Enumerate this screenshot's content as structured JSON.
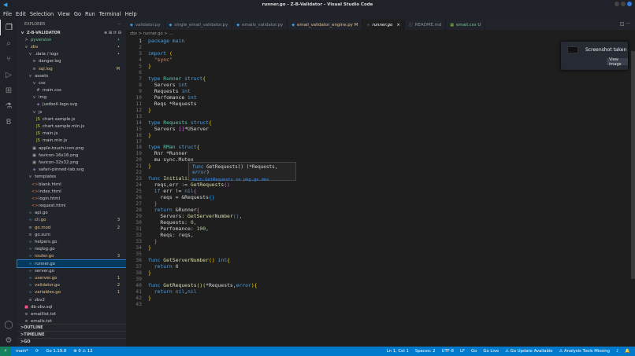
{
  "title": "runner.go - Z-B-Validator - Visual Studio Code",
  "menu": [
    "File",
    "Edit",
    "Selection",
    "View",
    "Go",
    "Run",
    "Terminal",
    "Help"
  ],
  "sidebar": {
    "header": "EXPLORER",
    "root": "Z-B-VALIDATOR",
    "items": [
      {
        "label": "pyversion",
        "indent": 1,
        "icon": ">",
        "color": "#73c991",
        "badge": "•"
      },
      {
        "label": "zbv",
        "indent": 1,
        "icon": "v",
        "color": "#e2c08d",
        "badge": "•"
      },
      {
        "label": ".data / logs",
        "indent": 2,
        "icon": "v",
        "color": "#ccc",
        "badge": "•"
      },
      {
        "label": "danger.log",
        "indent": 3,
        "icon": "≡",
        "color": "#ccc",
        "badge": ""
      },
      {
        "label": "sql.log",
        "indent": 3,
        "icon": "≡",
        "color": "#e2c08d",
        "badge": "M"
      },
      {
        "label": "assets",
        "indent": 2,
        "icon": "v",
        "color": "#ccc",
        "badge": ""
      },
      {
        "label": "css",
        "indent": 3,
        "icon": "v",
        "color": "#ccc",
        "badge": ""
      },
      {
        "label": "main.css",
        "indent": 4,
        "icon": "#",
        "color": "#ccc",
        "badge": ""
      },
      {
        "label": "img",
        "indent": 3,
        "icon": "v",
        "color": "#ccc",
        "badge": ""
      },
      {
        "label": "justboil-logo.svg",
        "indent": 4,
        "icon": "◈",
        "color": "#ccc",
        "badge": ""
      },
      {
        "label": "js",
        "indent": 3,
        "icon": "v",
        "color": "#ccc",
        "badge": ""
      },
      {
        "label": "chart.sample.js",
        "indent": 4,
        "icon": "JS",
        "color": "#ccc",
        "badge": ""
      },
      {
        "label": "chart.sample.min.js",
        "indent": 4,
        "icon": "JS",
        "color": "#ccc",
        "badge": ""
      },
      {
        "label": "main.js",
        "indent": 4,
        "icon": "JS",
        "color": "#ccc",
        "badge": ""
      },
      {
        "label": "main.min.js",
        "indent": 4,
        "icon": "JS",
        "color": "#ccc",
        "badge": ""
      },
      {
        "label": "apple-touch-icon.png",
        "indent": 3,
        "icon": "▣",
        "color": "#ccc",
        "badge": ""
      },
      {
        "label": "favicon-16x16.png",
        "indent": 3,
        "icon": "▣",
        "color": "#ccc",
        "badge": ""
      },
      {
        "label": "favicon-32x32.png",
        "indent": 3,
        "icon": "▣",
        "color": "#ccc",
        "badge": ""
      },
      {
        "label": "safari-pinned-tab.svg",
        "indent": 3,
        "icon": "◈",
        "color": "#ccc",
        "badge": ""
      },
      {
        "label": "templates",
        "indent": 2,
        "icon": "v",
        "color": "#ccc",
        "badge": ""
      },
      {
        "label": "blank.html",
        "indent": 3,
        "icon": "<>",
        "color": "#ccc",
        "badge": ""
      },
      {
        "label": "index.html",
        "indent": 3,
        "icon": "<>",
        "color": "#ccc",
        "badge": ""
      },
      {
        "label": "login.html",
        "indent": 3,
        "icon": "<>",
        "color": "#ccc",
        "badge": ""
      },
      {
        "label": "request.html",
        "indent": 3,
        "icon": "<>",
        "color": "#ccc",
        "badge": ""
      },
      {
        "label": "api.go",
        "indent": 2,
        "icon": "∞",
        "color": "#ccc",
        "badge": ""
      },
      {
        "label": "cli.go",
        "indent": 2,
        "icon": "∞",
        "color": "#e2c08d",
        "badge": "3"
      },
      {
        "label": "go.mod",
        "indent": 2,
        "icon": "≡",
        "color": "#e2c08d",
        "badge": "2"
      },
      {
        "label": "go.sum",
        "indent": 2,
        "icon": "≡",
        "color": "#ccc",
        "badge": ""
      },
      {
        "label": "helpers.go",
        "indent": 2,
        "icon": "∞",
        "color": "#ccc",
        "badge": ""
      },
      {
        "label": "reqlog.go",
        "indent": 2,
        "icon": "∞",
        "color": "#ccc",
        "badge": ""
      },
      {
        "label": "router.go",
        "indent": 2,
        "icon": "∞",
        "color": "#e2c08d",
        "badge": "3"
      },
      {
        "label": "runner.go",
        "indent": 2,
        "icon": "∞",
        "color": "#ccc",
        "badge": "",
        "selected": true
      },
      {
        "label": "server.go",
        "indent": 2,
        "icon": "∞",
        "color": "#ccc",
        "badge": ""
      },
      {
        "label": "userver.go",
        "indent": 2,
        "icon": "∞",
        "color": "#e2c08d",
        "badge": "1"
      },
      {
        "label": "validator.go",
        "indent": 2,
        "icon": "∞",
        "color": "#e2c08d",
        "badge": "2"
      },
      {
        "label": "variables.go",
        "indent": 2,
        "icon": "∞",
        "color": "#e2c08d",
        "badge": "1"
      },
      {
        "label": "zbv2",
        "indent": 2,
        "icon": "≡",
        "color": "#ccc",
        "badge": ""
      },
      {
        "label": "db-zbv.sql",
        "indent": 1,
        "icon": "■",
        "color": "#ccc",
        "badge": ""
      },
      {
        "label": "emaillist.txt",
        "indent": 1,
        "icon": "≡",
        "color": "#ccc",
        "badge": ""
      },
      {
        "label": "emails.txt",
        "indent": 1,
        "icon": "≡",
        "color": "#ccc",
        "badge": ""
      }
    ],
    "sections": [
      "OUTLINE",
      "TIMELINE",
      "GO"
    ]
  },
  "tabs": [
    {
      "label": "validator.py",
      "icon": "◆",
      "color": "#8a8f98",
      "iconColor": "#3c9ee8"
    },
    {
      "label": "single_email_validator.py",
      "icon": "◆",
      "color": "#8a8f98",
      "iconColor": "#3c9ee8"
    },
    {
      "label": "emails_validator.py",
      "icon": "◆",
      "color": "#8a8f98",
      "iconColor": "#3c9ee8"
    },
    {
      "label": "email_validator_engine.py M",
      "icon": "◆",
      "color": "#e2c08d",
      "iconColor": "#3c9ee8"
    },
    {
      "label": "runner.go",
      "icon": "∞",
      "color": "#fff",
      "iconColor": "#519aba",
      "active": true,
      "close": "×"
    },
    {
      "label": "README.md",
      "icon": "ⓘ",
      "color": "#8a8f98",
      "iconColor": "#519aba"
    },
    {
      "label": "email.csv U",
      "icon": "▦",
      "color": "#73c991",
      "iconColor": "#8dc149"
    }
  ],
  "breadcrumb": "zbv > runner.go > ...",
  "code": [
    [
      [
        "package main",
        "kw"
      ]
    ],
    [],
    [
      [
        "import ",
        "kw"
      ],
      [
        "(",
        "br"
      ]
    ],
    [
      [
        "  \"sync\"",
        "st"
      ]
    ],
    [
      [
        "}",
        "br"
      ]
    ],
    [],
    [
      [
        "type ",
        "kw"
      ],
      [
        "Runner ",
        "ty"
      ],
      [
        "struct",
        "kw"
      ],
      [
        "{",
        "br"
      ]
    ],
    [
      [
        "  Servers ",
        "tx"
      ],
      [
        "int",
        "kw"
      ]
    ],
    [
      [
        "  Requests ",
        "tx"
      ],
      [
        "int",
        "kw"
      ]
    ],
    [
      [
        "  Perfomance ",
        "tx"
      ],
      [
        "int",
        "kw"
      ]
    ],
    [
      [
        "  Reqs *Requests",
        "tx"
      ]
    ],
    [
      [
        "}",
        "br"
      ]
    ],
    [],
    [
      [
        "type ",
        "kw"
      ],
      [
        "Requests ",
        "ty"
      ],
      [
        "struct",
        "kw"
      ],
      [
        "{",
        "br"
      ]
    ],
    [
      [
        "  Servers ",
        "tx"
      ],
      [
        "[]",
        "br2"
      ],
      [
        "*UServer",
        "tx"
      ]
    ],
    [
      [
        "}",
        "br"
      ]
    ],
    [],
    [
      [
        "type ",
        "kw"
      ],
      [
        "RMan ",
        "ty"
      ],
      [
        "struct",
        "kw"
      ],
      [
        "{",
        "br"
      ]
    ],
    [
      [
        "  Rnr *Runner",
        "tx"
      ]
    ],
    [
      [
        "  mu sync.Mutex",
        "tx"
      ]
    ],
    [
      [
        "}",
        "br"
      ]
    ],
    [],
    [
      [
        "func ",
        "kw"
      ],
      [
        "InitializeRunner",
        "fn"
      ]
    ],
    [
      [
        "  reqs,err := ",
        "tx"
      ],
      [
        "GetRequests",
        "fn"
      ],
      [
        "()",
        "br2"
      ]
    ],
    [
      [
        "  if ",
        "kw"
      ],
      [
        "err != ",
        "tx"
      ],
      [
        "nil",
        "kw"
      ],
      [
        "{",
        "br2"
      ]
    ],
    [
      [
        "    reqs = &Requests",
        "tx"
      ],
      [
        "{}",
        "br3"
      ]
    ],
    [
      [
        "  }",
        "br2"
      ]
    ],
    [
      [
        "  return ",
        "kw"
      ],
      [
        "&Runner",
        "tx"
      ],
      [
        "{",
        "br2"
      ]
    ],
    [
      [
        "    Servers: ",
        "tx"
      ],
      [
        "GetServerNumber",
        "fn"
      ],
      [
        "()",
        "br3"
      ],
      [
        ",",
        "tx"
      ]
    ],
    [
      [
        "    Requests: ",
        "tx"
      ],
      [
        "0",
        "nu"
      ],
      [
        ",",
        "tx"
      ]
    ],
    [
      [
        "    Perfomance: ",
        "tx"
      ],
      [
        "100",
        "nu"
      ],
      [
        ",",
        "tx"
      ]
    ],
    [
      [
        "    Reqs: reqs,",
        "tx"
      ]
    ],
    [
      [
        "  }",
        "br2"
      ]
    ],
    [
      [
        "}",
        "br"
      ]
    ],
    [],
    [
      [
        "func ",
        "kw"
      ],
      [
        "GetServerNumber",
        "fn"
      ],
      [
        "() ",
        "br"
      ],
      [
        "int",
        "kw"
      ],
      [
        "{",
        "br"
      ]
    ],
    [
      [
        "  return ",
        "kw"
      ],
      [
        "0",
        "nu"
      ]
    ],
    [
      [
        "}",
        "br"
      ]
    ],
    [],
    [
      [
        "func ",
        "kw"
      ],
      [
        "GetRequests",
        "fn"
      ],
      [
        "()",
        "br"
      ],
      [
        "(",
        "br"
      ],
      [
        "*Requests,",
        "tx"
      ],
      [
        "error",
        "kw"
      ],
      [
        "){",
        "br"
      ]
    ],
    [
      [
        "  return ",
        "kw"
      ],
      [
        "nil",
        "kw"
      ],
      [
        ",",
        "tx"
      ],
      [
        "nil",
        "kw"
      ]
    ],
    [
      [
        "}",
        "br"
      ]
    ],
    []
  ],
  "hover": {
    "signature_kw": "func",
    "signature": " GetRequests() (*Requests, ",
    "signature_err": "error",
    "signature_end": ")",
    "link1": "main.GetRequests",
    "link2": "on pkg.go.dev"
  },
  "toast": {
    "title": "Screenshot taken",
    "button": "View image"
  },
  "status": {
    "remote": "⚡",
    "branch": "main*",
    "sync": "⟳",
    "go": "Go 1.19.8",
    "problems": "⊗ 0 ⚠ 12",
    "right": [
      "Ln 1, Col 1",
      "Spaces: 2",
      "UTF-8",
      "LF",
      "Go",
      "Go Live",
      "⚠ Go Update Available",
      "⚠ Analysis Tools Missing",
      "♪",
      "🔔"
    ]
  }
}
